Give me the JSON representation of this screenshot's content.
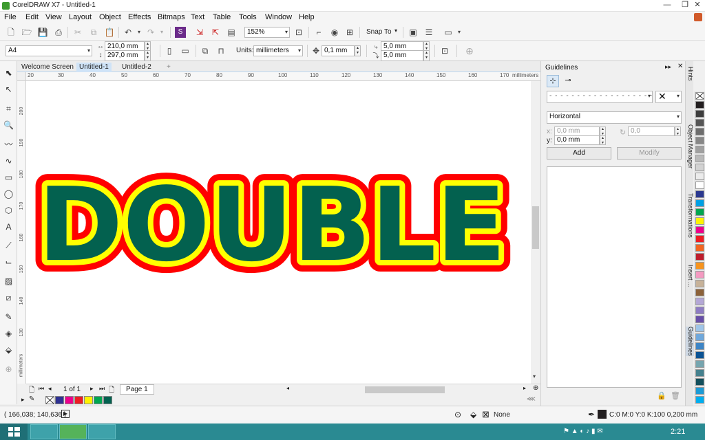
{
  "window": {
    "title": "CorelDRAW X7 - Untitled-1"
  },
  "menus": [
    "File",
    "Edit",
    "View",
    "Layout",
    "Object",
    "Effects",
    "Bitmaps",
    "Text",
    "Table",
    "Tools",
    "Window",
    "Help"
  ],
  "toolbar1": {
    "zoom": "152%",
    "snap_to": "Snap To"
  },
  "toolbar2": {
    "page_size": "A4",
    "width": "210,0 mm",
    "height": "297,0 mm",
    "units_label": "Units:",
    "units": "millimeters",
    "nudge": "0,1 mm",
    "dup_x": "5,0 mm",
    "dup_y": "5,0 mm"
  },
  "doc_tabs": [
    "Welcome Screen",
    "Untitled-1",
    "Untitled-2"
  ],
  "ruler": {
    "top_ticks": [
      "20",
      "30",
      "40",
      "50",
      "60",
      "70",
      "80",
      "90",
      "100",
      "110",
      "120",
      "130",
      "140",
      "150",
      "160",
      "170"
    ],
    "units": "millimeters",
    "left_ticks": [
      "200",
      "190",
      "180",
      "170",
      "160",
      "150",
      "140",
      "130"
    ],
    "left_units": "millimeters"
  },
  "artwork": {
    "text": "DOUBLE",
    "fill": "#03614f",
    "inner_outline": "#ffff00",
    "outer_outline": "#ff0000"
  },
  "pagebar": {
    "page_count": "1 of 1",
    "page_tab": "Page 1"
  },
  "docker": {
    "title": "Guidelines",
    "orientation": "Horizontal",
    "x_label": "x:",
    "x_value": "0,0 mm",
    "y_label": "y:",
    "y_value": "0,0 mm",
    "angle": "0,0",
    "add": "Add",
    "modify": "Modify"
  },
  "docker_tabs": [
    "Hints",
    "Object Manager",
    "Transformations",
    "Insert ...",
    "Guidelines"
  ],
  "status": {
    "coords": "( 166,038; 140,636 )",
    "fill": "None",
    "outline": "C:0 M:0 Y:0 K:100  0,200 mm"
  },
  "taskbar": {
    "time": "2:21"
  },
  "palette_colors": [
    "#231f20",
    "#3d3d3d",
    "#555555",
    "#6d6d6d",
    "#878787",
    "#a0a0a0",
    "#b9b9b9",
    "#d2d2d2",
    "#ebebeb",
    "#ffffff",
    "#2b3990",
    "#00a0e3",
    "#00a651",
    "#fff200",
    "#ec008c",
    "#ed1c24",
    "#f26522",
    "#be1e2d",
    "#f7941d",
    "#f49ac1",
    "#c7b299",
    "#8c6239",
    "#b4a7d6",
    "#8e7cc3",
    "#674ea7",
    "#9fc5e8",
    "#6fa8dc",
    "#3d85c6",
    "#0b5394",
    "#76a5af",
    "#45818e",
    "#134f5c",
    "#1c9bd6",
    "#00aeef"
  ],
  "doc_palette_colors": [
    "#2e3192",
    "#ec008c",
    "#ed1c24",
    "#fff200",
    "#00a651",
    "#03614f"
  ]
}
